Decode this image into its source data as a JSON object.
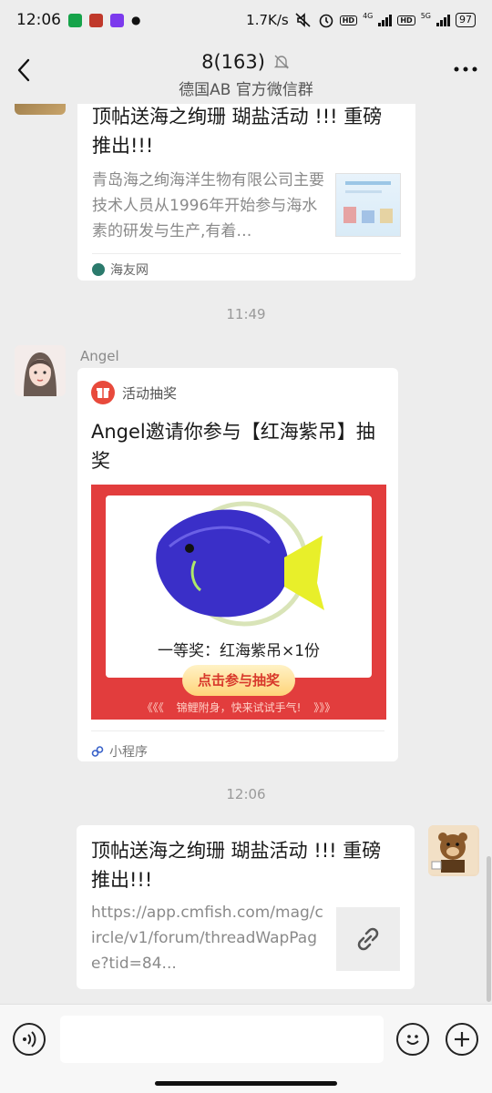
{
  "status_bar": {
    "time": "12:06",
    "network_speed": "1.7K/s",
    "network_4g": "4G",
    "network_5g": "5G",
    "hd1": "HD",
    "hd2": "HD",
    "battery": "97"
  },
  "header": {
    "title": "8(163)",
    "subtitle": "德国AB  官方微信群"
  },
  "messages": {
    "msg1": {
      "title": "顶帖送海之绚珊 瑚盐活动 !!! 重磅推出!!!",
      "description": "青岛海之绚海洋生物有限公司主要技术人员从1996年开始参与海水素的研发与生产,有着…",
      "source": "海友网"
    },
    "time1": "11:49",
    "msg2": {
      "sender": "Angel",
      "app_name": "活动抽奖",
      "title": "Angel邀请你参与【红海紫吊】抽奖",
      "prize_text": "一等奖：红海紫吊×1份",
      "join_button": "点击参与抽奖",
      "slogan": "锦鲤附身，快来试试手气!",
      "slogan_left": "《《《",
      "slogan_right": "》》》",
      "footer": "小程序"
    },
    "time2": "12:06",
    "msg3": {
      "title": "顶帖送海之绚珊 瑚盐活动 !!! 重磅推出!!!",
      "url": "https://app.cmfish.com/mag/circle/v1/forum/threadWapPage?tid=84..."
    }
  },
  "input_bar": {
    "placeholder": ""
  },
  "colors": {
    "background": "#ededed",
    "card": "#ffffff",
    "prize_red": "#e23d3d",
    "fish_blue": "#3a2fc8",
    "fish_yellow": "#e8ef2a"
  }
}
